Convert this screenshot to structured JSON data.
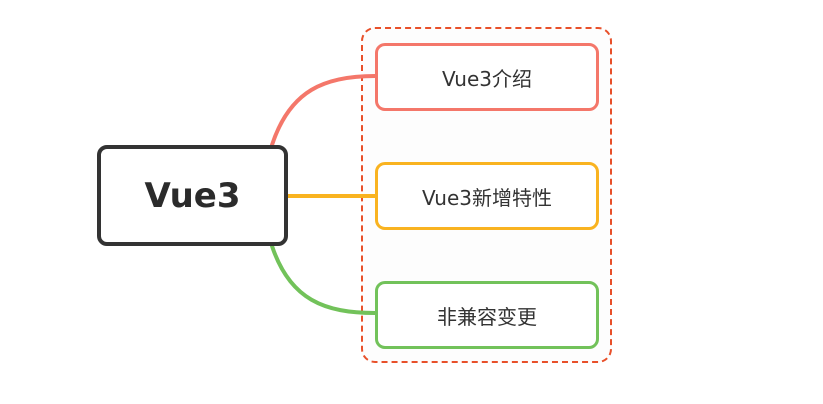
{
  "root": {
    "label": "Vue3"
  },
  "children": [
    {
      "label": "Vue3介绍",
      "color": "#f4776a"
    },
    {
      "label": "Vue3新增特性",
      "color": "#f9b320"
    },
    {
      "label": "非兼容变更",
      "color": "#72c25a"
    }
  ],
  "colors": {
    "root_border": "#333333",
    "group_border": "#e8502a"
  }
}
